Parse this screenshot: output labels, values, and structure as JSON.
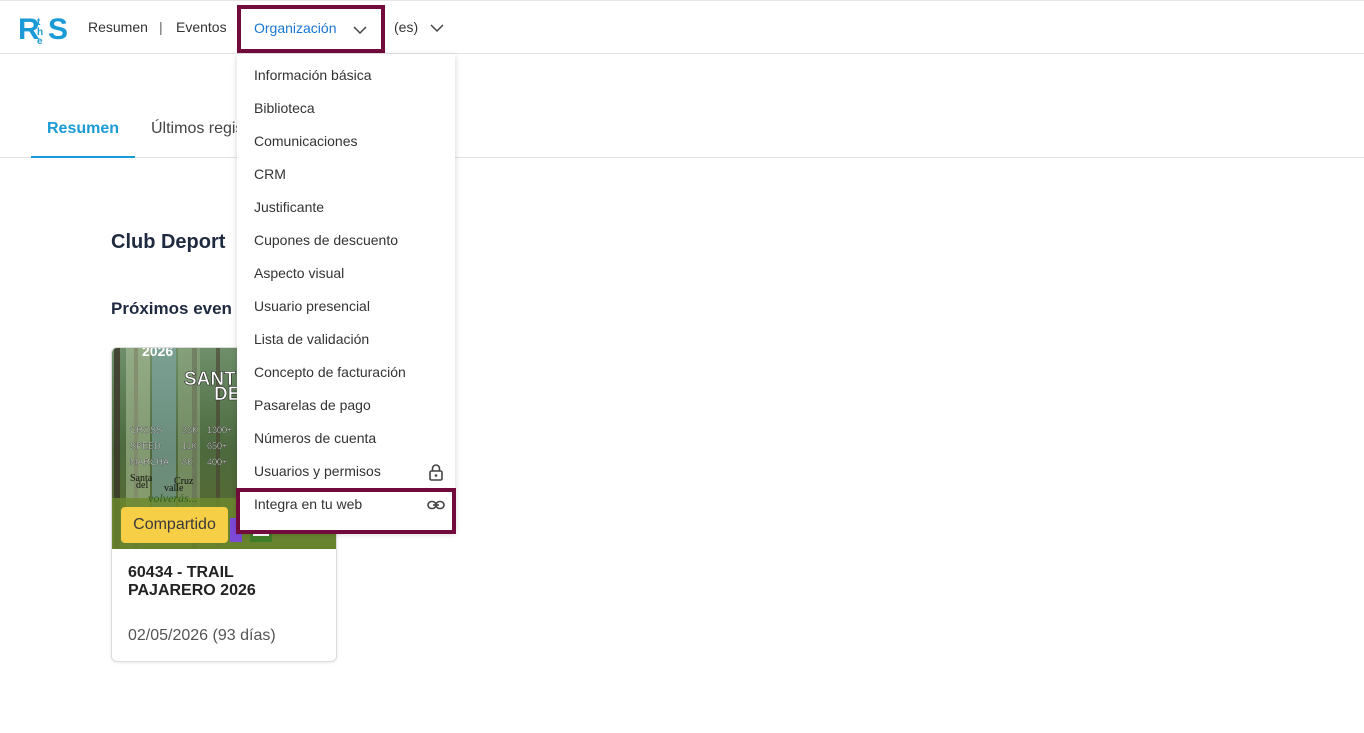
{
  "header": {
    "logo_text": "RES",
    "nav": {
      "resumen": "Resumen",
      "separator": "|",
      "eventos": "Eventos",
      "organizacion": "Organización",
      "language": "(es)"
    }
  },
  "tabs": {
    "active": "Resumen",
    "second": "Últimos regis"
  },
  "main": {
    "club_title": "Club Deport",
    "upcoming_title": "Próximos even"
  },
  "event_card": {
    "badge": "Compartido",
    "title": "60434 - TRAIL PAJARERO 2026",
    "date": "02/05/2026 (93 días)",
    "image": {
      "year": "2026",
      "title_line1": "SANT",
      "title_line2": "DE",
      "rows": [
        {
          "name": "CROSS",
          "dist": "23K",
          "elev": "1300+"
        },
        {
          "name": "SPEED",
          "dist": "11K",
          "elev": "650+"
        },
        {
          "name": "MARCHA",
          "dist": "8K",
          "elev": "400+"
        }
      ],
      "logo_words": [
        "Santa",
        "Cruz",
        "del",
        "valle",
        "volverás..."
      ]
    }
  },
  "dropdown": {
    "items": [
      {
        "label": "Información básica",
        "icon": ""
      },
      {
        "label": "Biblioteca",
        "icon": ""
      },
      {
        "label": "Comunicaciones",
        "icon": ""
      },
      {
        "label": "CRM",
        "icon": ""
      },
      {
        "label": "Justificante",
        "icon": ""
      },
      {
        "label": "Cupones de descuento",
        "icon": ""
      },
      {
        "label": "Aspecto visual",
        "icon": ""
      },
      {
        "label": "Usuario presencial",
        "icon": ""
      },
      {
        "label": "Lista de validación",
        "icon": ""
      },
      {
        "label": "Concepto de facturación",
        "icon": ""
      },
      {
        "label": "Pasarelas de pago",
        "icon": ""
      },
      {
        "label": "Números de cuenta",
        "icon": ""
      },
      {
        "label": "Usuarios y permisos",
        "icon": "lock-icon"
      },
      {
        "label": "Integra en tu web",
        "icon": "link-icon"
      }
    ]
  },
  "colors": {
    "accent": "#1b9bd6",
    "nav_active": "#1976d2",
    "highlight": "#730a3c",
    "badge": "#f6cf47"
  }
}
